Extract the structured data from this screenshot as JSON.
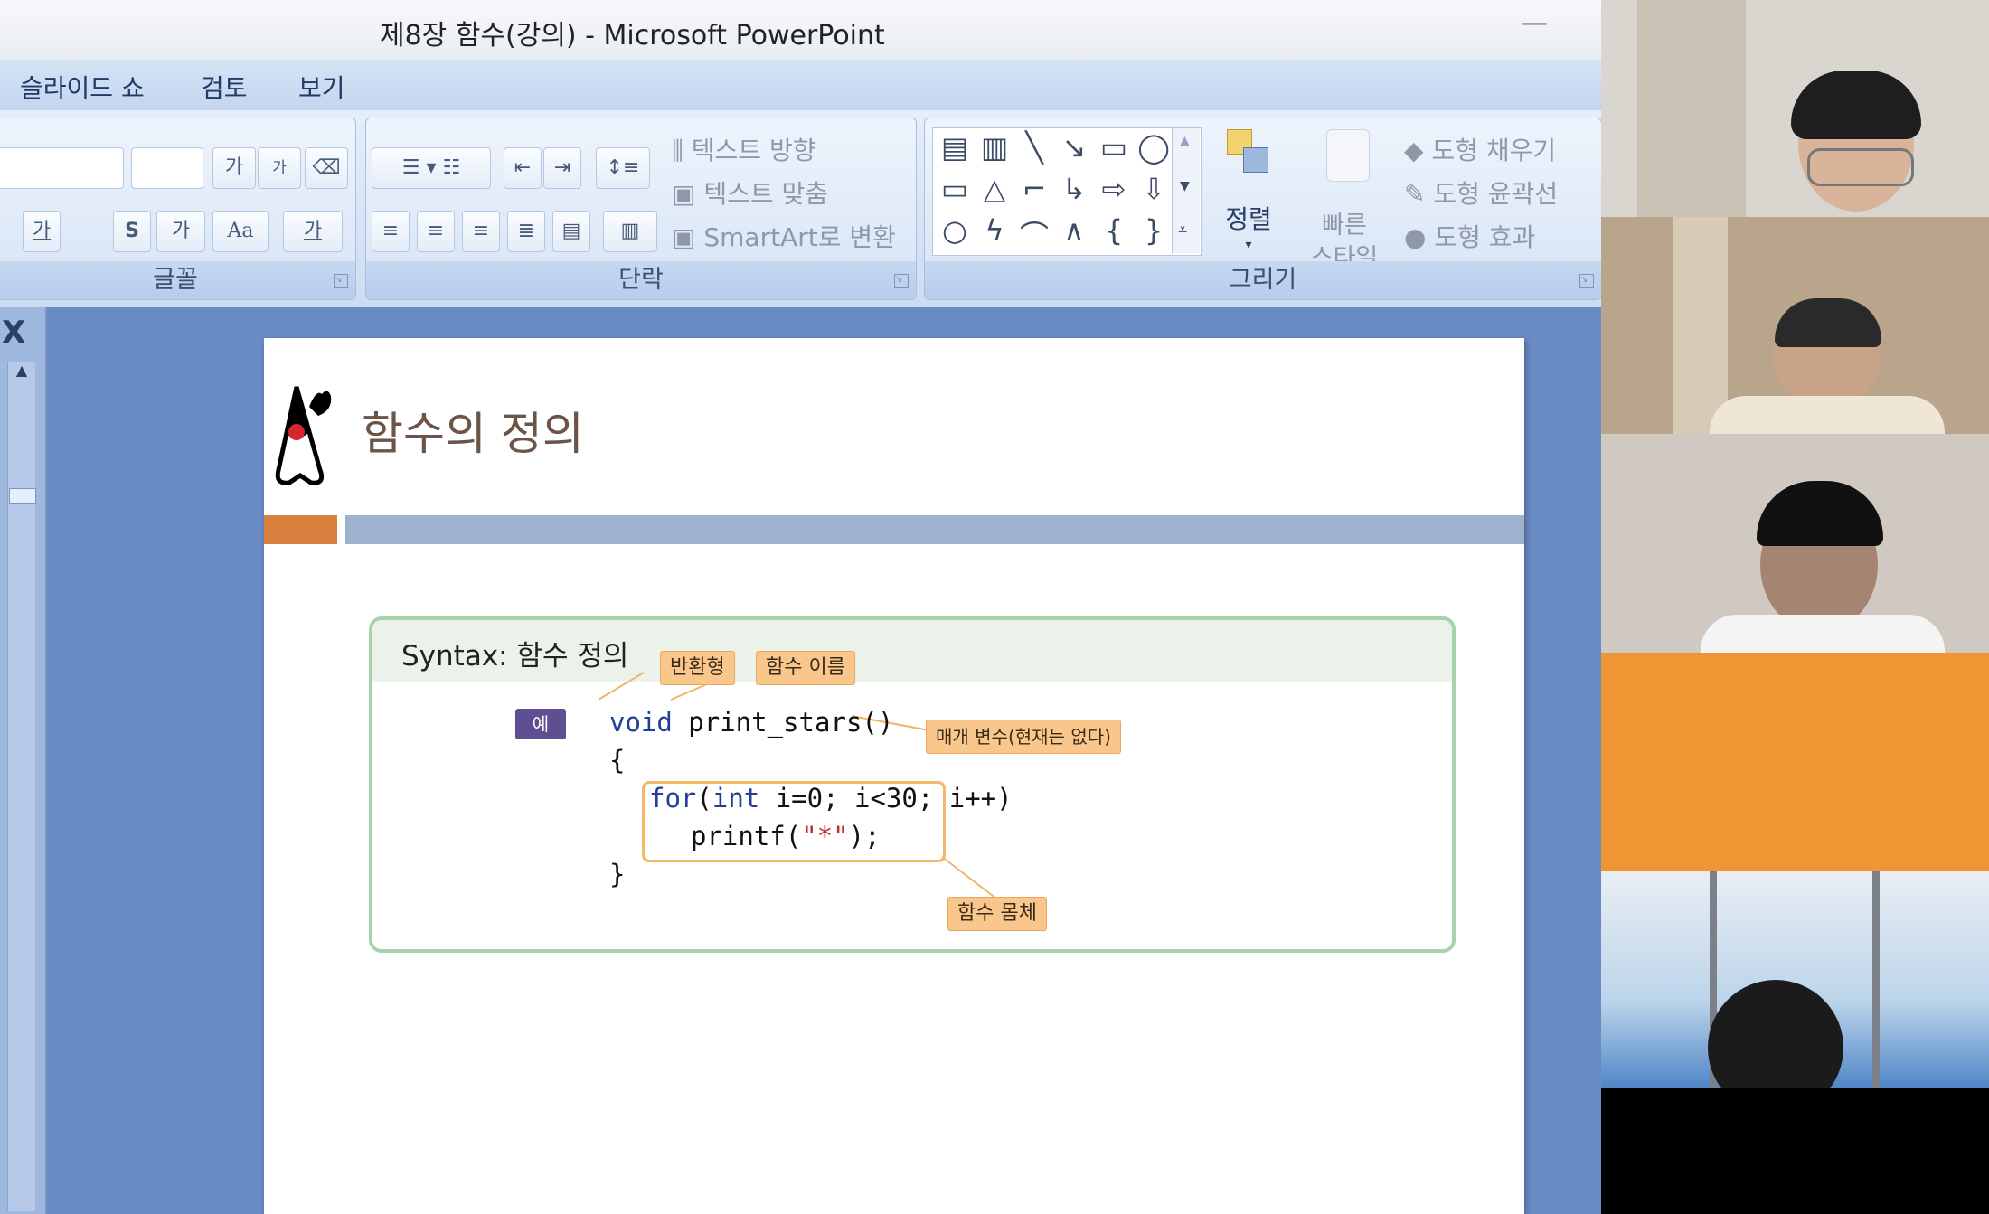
{
  "window": {
    "title": "제8장 함수(강의) - Microsoft PowerPoint",
    "minimize": "—"
  },
  "menu": {
    "tabs": [
      "슬라이드 쇼",
      "검토",
      "보기"
    ]
  },
  "ribbon": {
    "font_group": {
      "label": "글꼴",
      "buttons": [
        "가",
        "가",
        "가",
        "S",
        "가",
        "Aa",
        "가"
      ]
    },
    "paragraph_group": {
      "label": "단락",
      "text_direction": "텍스트 방향",
      "align_text": "텍스트 맞춤",
      "smartart": "SmartArt로 변환"
    },
    "drawing_group": {
      "label": "그리기",
      "arrange": "정렬",
      "quick_styles_1": "빠른",
      "quick_styles_2": "스타일",
      "shape_fill": "도형 채우기",
      "shape_outline": "도형 윤곽선",
      "shape_effects": "도형 효과",
      "shapes": [
        "▭",
        "△",
        "⌐",
        "⇨",
        "⇩",
        "○",
        "{",
        "}"
      ]
    }
  },
  "left_pane": {
    "close_icon": "X"
  },
  "slide": {
    "title": "함수의 정의",
    "syntax_heading": "Syntax:  함수 정의",
    "example_badge": "예",
    "callouts": {
      "return_type": "반환형",
      "function_name": "함수 이름",
      "parameters": "매개 변수(현재는 없다)",
      "function_body": "함수 몸체"
    },
    "code": {
      "void_kw": "void",
      "signature_rest": " print_stars()",
      "open_brace": "{",
      "for_kw": "for",
      "paren": "(",
      "int_kw": "int",
      "for_rest": " i=0; i<30; i++)",
      "printf_pre": "printf(",
      "printf_str": "\"*\"",
      "printf_post": ");",
      "close_brace": "}"
    }
  },
  "participants": [
    {
      "name": "participant-1",
      "bg": "#d8d6cf"
    },
    {
      "name": "participant-2",
      "bg": "#b9a48c"
    },
    {
      "name": "participant-3",
      "bg": "#cfc9c2"
    },
    {
      "name": "participant-4",
      "bg": "#f09534"
    },
    {
      "name": "participant-5",
      "bg": "#dfe6ee"
    }
  ]
}
